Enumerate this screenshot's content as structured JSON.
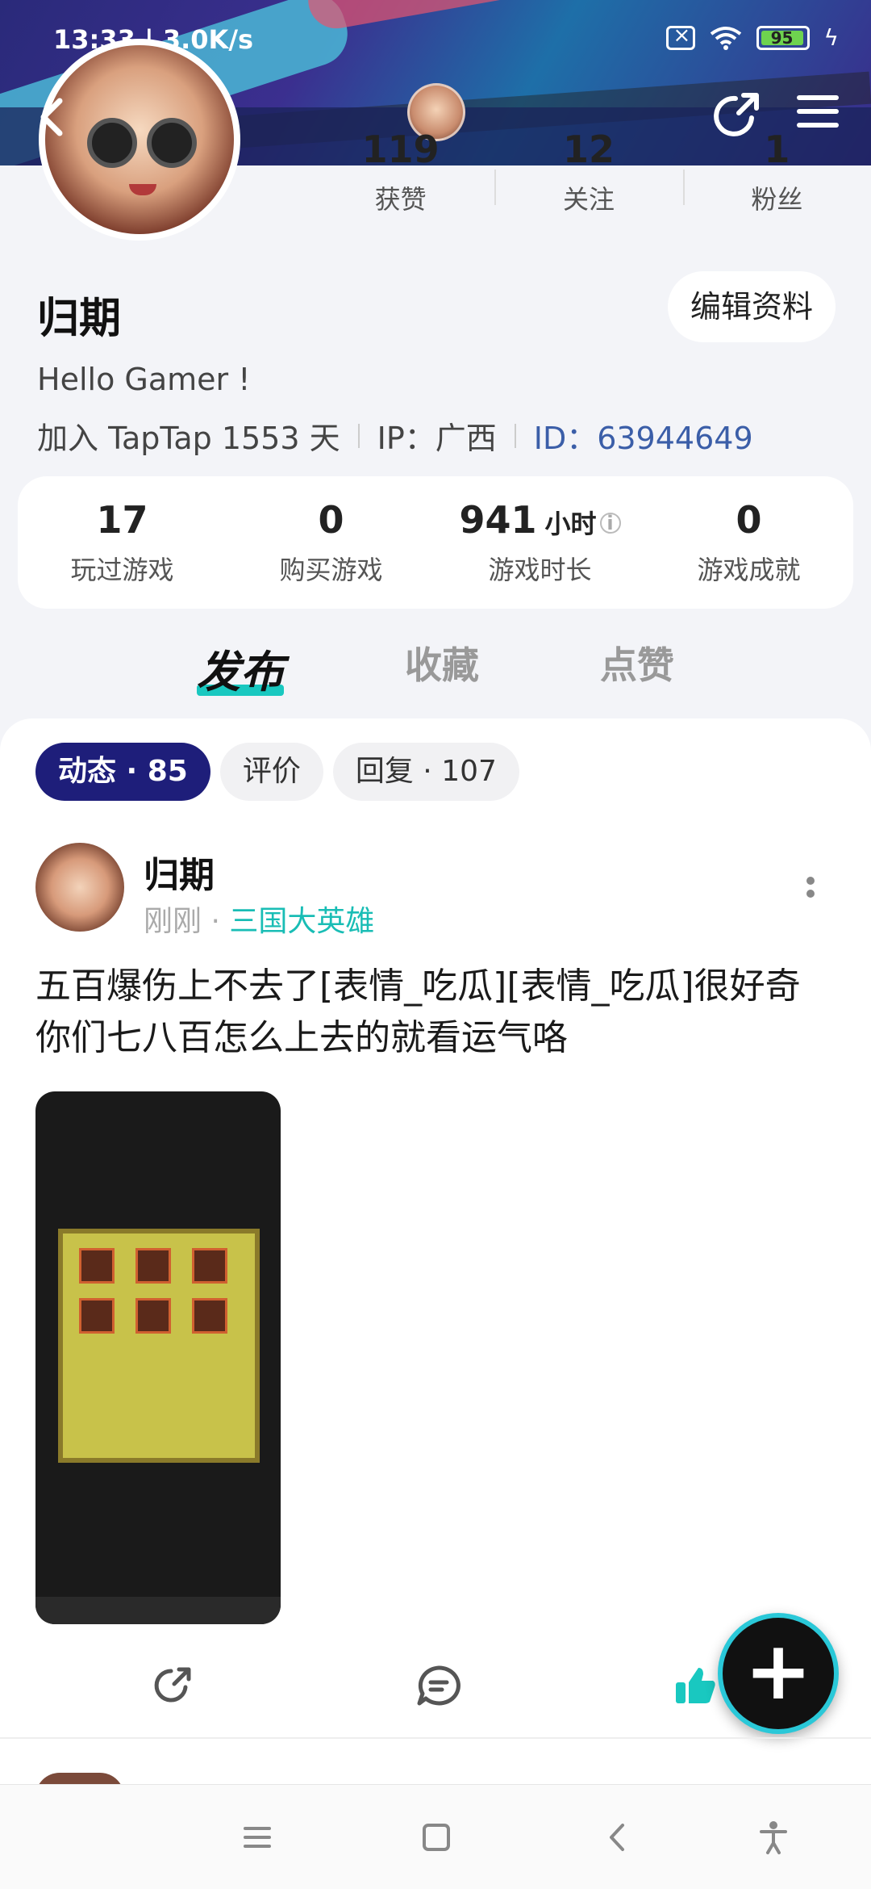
{
  "status_bar": {
    "time": "13:33 | 3.0K/s",
    "battery": "95"
  },
  "profile": {
    "name": "归期",
    "edit_label": "编辑资料",
    "bio": "Hello Gamer !",
    "joined": "加入 TapTap 1553 天",
    "ip": "IP：广西",
    "id": "ID：63944649",
    "stats": [
      {
        "num": "119",
        "label": "获赞"
      },
      {
        "num": "12",
        "label": "关注"
      },
      {
        "num": "1",
        "label": "粉丝"
      }
    ]
  },
  "game_stats": [
    {
      "num": "17",
      "unit": "",
      "label": "玩过游戏"
    },
    {
      "num": "0",
      "unit": "",
      "label": "购买游戏"
    },
    {
      "num": "941",
      "unit": "小时",
      "label": "游戏时长"
    },
    {
      "num": "0",
      "unit": "",
      "label": "游戏成就"
    }
  ],
  "tabs": [
    "发布",
    "收藏",
    "点赞"
  ],
  "chips": [
    "动态 · 85",
    "评价",
    "回复 · 107"
  ],
  "post": {
    "author": "归期",
    "time": "刚刚",
    "separator": "·",
    "game": "三国大英雄",
    "text": "五百爆伤上不去了[表情_吃瓜][表情_吃瓜]很好奇你们七八百怎么上去的就看运气咯"
  },
  "colors": {
    "accent": "#19c8c0",
    "chip_active": "#1e1e7a",
    "link": "#3b5ea8"
  }
}
